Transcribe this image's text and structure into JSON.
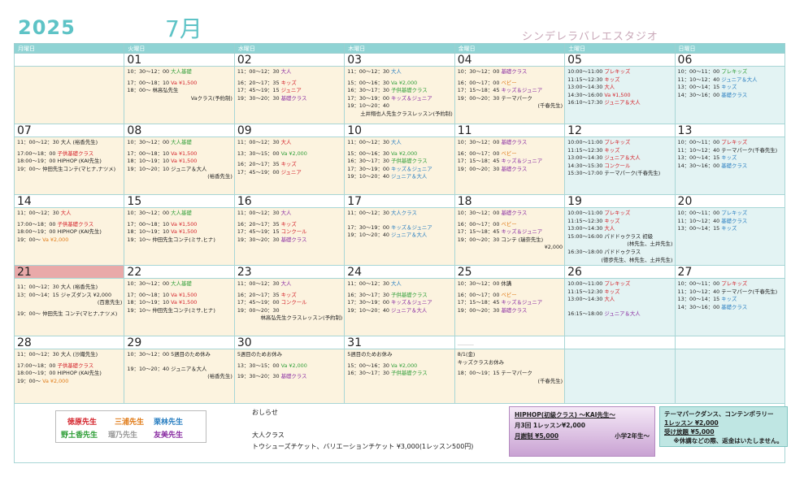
{
  "header": {
    "year": "2025",
    "month": "7月",
    "studio": "シンデレラバレエスタジオ"
  },
  "weekdays": [
    "月曜日",
    "火曜日",
    "水曜日",
    "木曜日",
    "金曜日",
    "土曜日",
    "日曜日"
  ],
  "weeks": [
    [
      {
        "day": "",
        "lines": []
      },
      {
        "day": "01",
        "lines": [
          {
            "t": "10：30〜12：00",
            "c": "大人基礎",
            "k": "green"
          },
          {
            "gap": true
          },
          {
            "t": "17：00〜18：10",
            "c": "Va ¥1,500",
            "k": "red"
          },
          {
            "t": "18：00〜 林高弘先生"
          },
          {
            "t": "Vaクラス(予約制)",
            "r": true
          }
        ]
      },
      {
        "day": "02",
        "lines": [
          {
            "t": "11：00〜12：30",
            "c": "大人",
            "k": "purple"
          },
          {
            "gap": true
          },
          {
            "t": "16：20〜17：35",
            "c": "キッズ",
            "k": "red"
          },
          {
            "t": "17：45〜19：15",
            "c": "ジュニア",
            "k": "red"
          },
          {
            "t": "19：30〜20：30",
            "c": "基礎クラス",
            "k": "purple"
          }
        ]
      },
      {
        "day": "03",
        "lines": [
          {
            "t": "11：00〜12：30",
            "c": "大人",
            "k": "blue"
          },
          {
            "gap": true
          },
          {
            "t": "15：00〜16：30",
            "c": "Va ¥2,000",
            "k": "green"
          },
          {
            "t": "16：30〜17：30",
            "c": "子供基礎クラス",
            "k": "green"
          },
          {
            "t": "17：30〜19：00",
            "c": "キッズ＆ジュニア",
            "k": "purple"
          },
          {
            "t": "19：10〜20：40"
          },
          {
            "t": "土井翔也人先生クラスレッスン(予約制)",
            "r": true
          }
        ]
      },
      {
        "day": "04",
        "lines": [
          {
            "t": "10：30〜12：00",
            "c": "基礎クラス",
            "k": "purple"
          },
          {
            "gap": true
          },
          {
            "t": "16：00〜17：00",
            "c": "ベビー",
            "k": "orange"
          },
          {
            "t": "17：15〜18：45",
            "c": "キッズ＆ジュニア",
            "k": "purple"
          },
          {
            "t": "19：00〜20：30",
            "c": "テーマパーク"
          },
          {
            "t": "(千春先生)",
            "r": true
          }
        ]
      },
      {
        "day": "05",
        "lines": [
          {
            "t": "10:00〜11:00",
            "c": "プレキッズ",
            "k": "red"
          },
          {
            "t": "11:15〜12:30",
            "c": "キッズ",
            "k": "red"
          },
          {
            "t": "13:00〜14:30",
            "c": "大人",
            "k": "red"
          },
          {
            "t": "14:30〜16:00",
            "c": "Va ¥1,500",
            "k": "red"
          },
          {
            "t": "16:10〜17:30",
            "c": "ジュニア＆大人",
            "k": "red"
          }
        ]
      },
      {
        "day": "06",
        "lines": [
          {
            "t": "10：00〜11：00",
            "c": "プレキッズ",
            "k": "green"
          },
          {
            "t": "11：10〜12：40",
            "c": "ジュニア＆大人",
            "k": "blue"
          },
          {
            "t": "13：00〜14：15",
            "c": "キッズ",
            "k": "blue"
          },
          {
            "t": "14：30〜16：00",
            "c": "基礎クラス",
            "k": "blue"
          }
        ]
      }
    ],
    [
      {
        "day": "07",
        "lines": [
          {
            "t": "11：00〜12：30 大人 (裕香先生)"
          },
          {
            "gap": true
          },
          {
            "t": "17:00〜18：00",
            "c": "子供基礎クラス",
            "k": "red"
          },
          {
            "t": "18:00〜19：00 HIPHOP (KAI先生)"
          },
          {
            "t": "19：00〜 仲田先生コンテ(マヒナ,ナツメ)"
          }
        ]
      },
      {
        "day": "08",
        "lines": [
          {
            "t": "10：30〜12：00",
            "c": "大人基礎",
            "k": "green"
          },
          {
            "gap": true
          },
          {
            "t": "17：00〜18：10",
            "c": "Va ¥1,500",
            "k": "red"
          },
          {
            "t": "18：10〜19：10",
            "c": "Va ¥1,500",
            "k": "red"
          },
          {
            "t": "19：10〜20：10 ジュニア＆大人"
          },
          {
            "t": "(裕香先生)",
            "r": true
          }
        ]
      },
      {
        "day": "09",
        "lines": [
          {
            "t": "11：00〜12：30",
            "c": "大人",
            "k": "red"
          },
          {
            "gap": true
          },
          {
            "t": "13：30〜15：00",
            "c": "Va ¥2,000",
            "k": "green"
          },
          {
            "gap": true
          },
          {
            "t": "16：20〜17：35",
            "c": "キッズ",
            "k": "red"
          },
          {
            "t": "17：45〜19：00",
            "c": "ジュニア",
            "k": "red"
          }
        ]
      },
      {
        "day": "10",
        "lines": [
          {
            "t": "11：00〜12：30",
            "c": "大人",
            "k": "blue"
          },
          {
            "gap": true
          },
          {
            "t": "15：00〜16：30",
            "c": "Va ¥2,000",
            "k": "green"
          },
          {
            "t": "16：30〜17：30",
            "c": "子供基礎クラス",
            "k": "green"
          },
          {
            "t": "17：30〜19：00",
            "c": "キッズ＆ジュニア",
            "k": "blue"
          },
          {
            "t": "19：10〜20：40",
            "c": "ジュニア＆大人",
            "k": "blue"
          }
        ]
      },
      {
        "day": "11",
        "lines": [
          {
            "t": "10：30〜12：00",
            "c": "基礎クラス",
            "k": "purple"
          },
          {
            "gap": true
          },
          {
            "t": "16：00〜17：00",
            "c": "ベビー",
            "k": "orange"
          },
          {
            "t": "17：15〜18：45",
            "c": "キッズ＆ジュニア",
            "k": "purple"
          },
          {
            "t": "19：00〜20：30",
            "c": "基礎クラス",
            "k": "purple"
          }
        ]
      },
      {
        "day": "12",
        "lines": [
          {
            "t": "10:00〜11:00",
            "c": "プレキッズ",
            "k": "red"
          },
          {
            "t": "11:15〜12:30",
            "c": "キッズ",
            "k": "red"
          },
          {
            "t": "13:00〜14:30",
            "c": "ジュニア＆大人",
            "k": "red"
          },
          {
            "t": "14:30〜15:30",
            "c": "コンクール",
            "k": "red"
          },
          {
            "t": "15:30〜17:00 テーマパーク(千春先生)"
          }
        ]
      },
      {
        "day": "13",
        "lines": [
          {
            "t": "10：00〜11：00",
            "c": "プレキッズ",
            "k": "red"
          },
          {
            "t": "11：10〜12：40 テーマパーク(千春先生)"
          },
          {
            "t": "13：00〜14：15",
            "c": "キッズ",
            "k": "blue"
          },
          {
            "t": "14：30〜16：00",
            "c": "基礎クラス",
            "k": "blue"
          }
        ]
      }
    ],
    [
      {
        "day": "14",
        "lines": [
          {
            "t": "11：00〜12：30",
            "c": "大人",
            "k": "red"
          },
          {
            "gap": true
          },
          {
            "t": "17:00〜18：00",
            "c": "子供基礎クラス",
            "k": "red"
          },
          {
            "t": "18:00〜19：00 HIPHOP (KAI先生)"
          },
          {
            "t": "19：00〜",
            "c": "Va ¥2,000",
            "k": "orange"
          }
        ]
      },
      {
        "day": "15",
        "lines": [
          {
            "t": "10：30〜12：00",
            "c": "大人基礎",
            "k": "green"
          },
          {
            "gap": true
          },
          {
            "t": "17：00〜18：10",
            "c": "Va ¥1,500",
            "k": "red"
          },
          {
            "t": "18：10〜19：10",
            "c": "Va ¥1,500",
            "k": "red"
          },
          {
            "t": "19：10〜 仲田先生コンテ(ミサ,ヒナ)"
          }
        ]
      },
      {
        "day": "16",
        "lines": [
          {
            "t": "11：00〜12：30",
            "c": "大人",
            "k": "purple"
          },
          {
            "gap": true
          },
          {
            "t": "16：20〜17：35",
            "c": "キッズ",
            "k": "red"
          },
          {
            "t": "17：45〜19：15",
            "c": "コンクール",
            "k": "red"
          },
          {
            "t": "19：30〜20：30",
            "c": "基礎クラス",
            "k": "purple"
          }
        ]
      },
      {
        "day": "17",
        "lines": [
          {
            "t": "11：00〜12：30",
            "c": "大人クラス",
            "k": "blue"
          },
          {
            "gap": true
          },
          {
            "gap": true
          },
          {
            "t": "17：30〜19：00",
            "c": "キッズ＆ジュニア",
            "k": "blue"
          },
          {
            "t": "19：10〜20：40",
            "c": "ジュニア＆大人",
            "k": "blue"
          }
        ]
      },
      {
        "day": "18",
        "lines": [
          {
            "t": "10：30〜12：00",
            "c": "基礎クラス",
            "k": "purple"
          },
          {
            "gap": true
          },
          {
            "t": "16：00〜17：00",
            "c": "ベビー",
            "k": "orange"
          },
          {
            "t": "17：15〜18：45",
            "c": "キッズ＆ジュニア",
            "k": "purple"
          },
          {
            "t": "19：00〜20：30 コンテ (瑞奈先生)"
          },
          {
            "t": "¥2,000",
            "r": true
          }
        ]
      },
      {
        "day": "19",
        "lines": [
          {
            "t": "10:00〜11:00",
            "c": "プレキッズ",
            "k": "red"
          },
          {
            "t": "11:15〜12:30",
            "c": "キッズ",
            "k": "red"
          },
          {
            "t": "13:00〜14:30",
            "c": "大人",
            "k": "red"
          },
          {
            "t": "15:00〜16:00 パドドゥクラス 初級"
          },
          {
            "t": "(林先生、土井先生)",
            "r": true
          },
          {
            "t": "16:30〜18:00 パドドゥクラス"
          },
          {
            "t": "(徳歩先生、林先生、土井先生)",
            "r": true
          }
        ]
      },
      {
        "day": "20",
        "lines": [
          {
            "t": "10：00〜11：00",
            "c": "プレキッズ",
            "k": "blue"
          },
          {
            "t": "11：10〜12：40",
            "c": "基礎クラス",
            "k": "blue"
          },
          {
            "t": "13：00〜14：15",
            "c": "キッズ",
            "k": "blue"
          }
        ]
      }
    ],
    [
      {
        "day": "21",
        "hl": true,
        "lines": [
          {
            "gap": true
          },
          {
            "t": "11：00〜12：30 大人 (裕香先生)"
          },
          {
            "t": "13：00〜14：15 ジャズダンス ¥2,000"
          },
          {
            "t": "(百恵先生)",
            "r": true
          },
          {
            "gap": true
          },
          {
            "t": "19：00〜 仲田先生 コンテ(マヒナ,ナツメ)"
          }
        ]
      },
      {
        "day": "22",
        "lines": [
          {
            "t": "10：30〜12：00",
            "c": "大人基礎",
            "k": "green"
          },
          {
            "gap": true
          },
          {
            "t": "17：00〜18：10",
            "c": "Va ¥1,500",
            "k": "red"
          },
          {
            "t": "18：10〜19：10",
            "c": "Va ¥1,500",
            "k": "red"
          },
          {
            "t": "19：10〜 仲田先生コンテ(ミサ,ヒナ)"
          }
        ]
      },
      {
        "day": "23",
        "lines": [
          {
            "t": "11：00〜12：30",
            "c": "大人",
            "k": "purple"
          },
          {
            "gap": true
          },
          {
            "t": "16：20〜17：35",
            "c": "キッズ",
            "k": "red"
          },
          {
            "t": "17：45〜19：00",
            "c": "コンクール",
            "k": "red"
          },
          {
            "t": "19：00〜20：30"
          },
          {
            "t": "林高弘先生クラスレッスン(予約制)",
            "r": true
          }
        ]
      },
      {
        "day": "24",
        "lines": [
          {
            "t": "11：00〜12：30",
            "c": "大人",
            "k": "blue"
          },
          {
            "gap": true
          },
          {
            "t": "16：30〜17：30",
            "c": "子供基礎クラス",
            "k": "green"
          },
          {
            "t": "17：30〜19：00",
            "c": "キッズ＆ジュニア",
            "k": "purple"
          },
          {
            "t": "19：10〜20：40",
            "c": "ジュニア＆大人",
            "k": "purple"
          }
        ]
      },
      {
        "day": "25",
        "lines": [
          {
            "t": "10：30〜12：00 休講"
          },
          {
            "gap": true
          },
          {
            "t": "16：00〜17：00",
            "c": "ベビー",
            "k": "orange"
          },
          {
            "t": "17：15〜18：45",
            "c": "キッズ＆ジュニア",
            "k": "purple"
          },
          {
            "t": "19：00〜20：30",
            "c": "基礎クラス",
            "k": "purple"
          }
        ]
      },
      {
        "day": "26",
        "lines": [
          {
            "t": "10:00〜11:00",
            "c": "プレキッズ",
            "k": "red"
          },
          {
            "t": "11:15〜12:30",
            "c": "キッズ",
            "k": "red"
          },
          {
            "t": "13:00〜14:30",
            "c": "大人",
            "k": "red"
          },
          {
            "gap": true
          },
          {
            "gap": true
          },
          {
            "t": "16:15〜18:00",
            "c": "ジュニア＆大人",
            "k": "purple"
          }
        ]
      },
      {
        "day": "27",
        "lines": [
          {
            "t": "10：00〜11：00",
            "c": "プレキッズ",
            "k": "red"
          },
          {
            "t": "11：10〜12：40 テーマパーク(千春先生)"
          },
          {
            "t": "13：00〜14：15",
            "c": "キッズ",
            "k": "blue"
          },
          {
            "t": "14：30〜16：00",
            "c": "基礎クラス",
            "k": "blue"
          }
        ]
      }
    ],
    [
      {
        "day": "28",
        "lines": [
          {
            "t": "11：00〜12：30 大人 (沙織先生)"
          },
          {
            "gap": true
          },
          {
            "t": "17:00〜18：00",
            "c": "子供基礎クラス",
            "k": "red"
          },
          {
            "t": "18:00〜19：00 HIPHOP (KAI先生)"
          },
          {
            "t": "19：00〜",
            "c": "Va ¥2,000",
            "k": "orange"
          }
        ]
      },
      {
        "day": "29",
        "lines": [
          {
            "t": "10：30〜12：00 5週目のため休み"
          },
          {
            "gap": true
          },
          {
            "gap": true
          },
          {
            "t": "19：10〜20：40 ジュニア＆大人"
          },
          {
            "t": "(裕香先生)",
            "r": true
          }
        ]
      },
      {
        "day": "30",
        "lines": [
          {
            "t": "5週目のためお休み"
          },
          {
            "gap": true
          },
          {
            "t": "13：30〜15：00",
            "c": "Va ¥2,000",
            "k": "green"
          },
          {
            "gap": true
          },
          {
            "t": "19：30〜20：30",
            "c": "基礎クラス",
            "k": "purple"
          }
        ]
      },
      {
        "day": "31",
        "lines": [
          {
            "t": "5週目のためお休み"
          },
          {
            "gap": true
          },
          {
            "t": "15：00〜16：30",
            "c": "Va ¥2,000",
            "k": "green"
          },
          {
            "t": "16：30〜17：30",
            "c": "子供基礎クラス",
            "k": "green"
          }
        ]
      },
      {
        "day": "＿＿",
        "dim": true,
        "lines": [
          {
            "t": "8/1(金)"
          },
          {
            "t": "キッズクラスお休み"
          },
          {
            "gap": true
          },
          {
            "t": "18：00〜19：15 テーマパーク"
          },
          {
            "t": "(千春先生)",
            "r": true
          }
        ]
      },
      {
        "day": "",
        "lines": []
      },
      {
        "day": "",
        "lines": []
      }
    ]
  ],
  "legend": [
    {
      "name": "徳原先生",
      "color": "#d4232b"
    },
    {
      "name": "三浦先生",
      "color": "#e07a16"
    },
    {
      "name": "栗林先生",
      "color": "#2a7fc1"
    },
    {
      "name": "野土香先生",
      "color": "#2e9e37"
    },
    {
      "name": "瑠乃先生",
      "color": "#9a9a9a"
    },
    {
      "name": "友美先生",
      "color": "#8b2fa3"
    }
  ],
  "notice": {
    "title": "おしらせ",
    "line1": "大人クラス",
    "line2": "トウシューズチケット、バリエーションチケット ¥3,000(1レッスン500円)"
  },
  "hiphop": {
    "title": "HIPHOP(初級クラス) 〜KAI先生〜",
    "line1": "月3回 1レッスン¥2,000",
    "line2": "月謝制 ¥5,000",
    "line3": "小学2年生〜"
  },
  "theme": {
    "title": "テーマパークダンス、コンテンポラリー",
    "line1": "1レッスン ¥2,000",
    "line2": "受け放題 ¥5,000",
    "line3": "※休講などの際、返金はいたしません。"
  }
}
